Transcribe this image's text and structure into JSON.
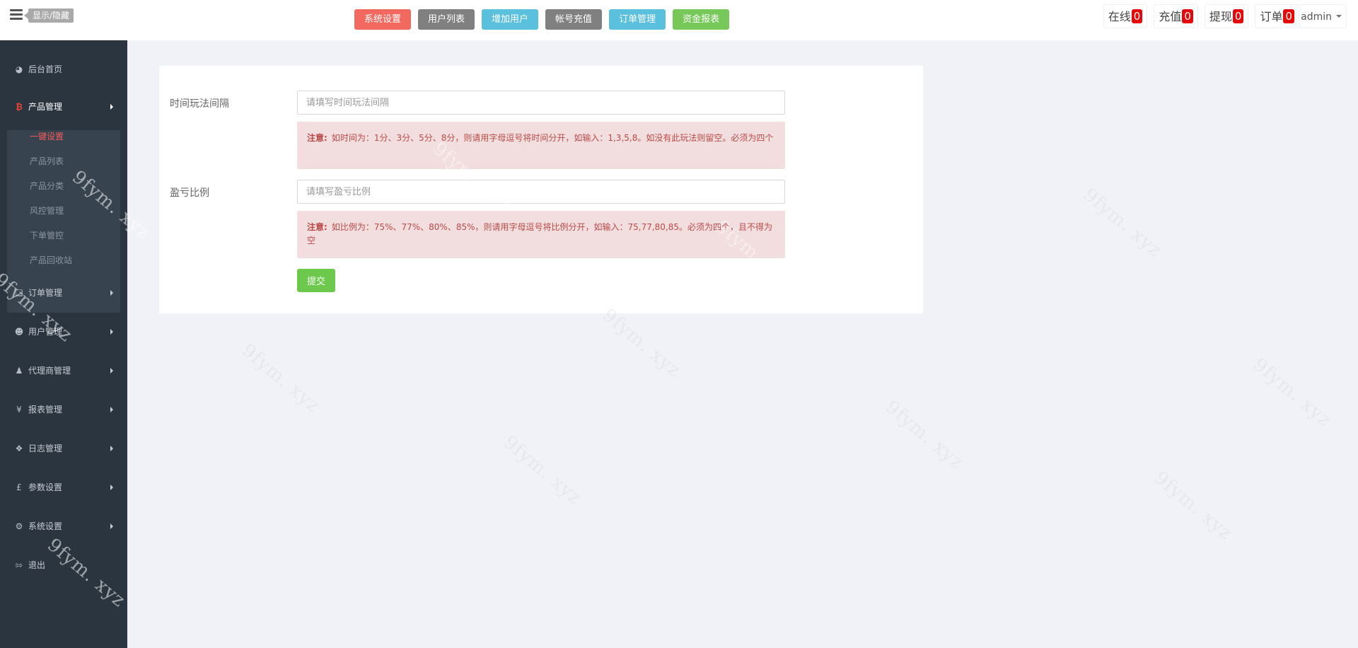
{
  "header": {
    "toggle_tip": "显示/隐藏",
    "quick_nav": [
      {
        "label": "系统设置",
        "color": "#f2695f"
      },
      {
        "label": "用户列表",
        "color": "#808080"
      },
      {
        "label": "增加用户",
        "color": "#5bc0de"
      },
      {
        "label": "帐号充值",
        "color": "#808080"
      },
      {
        "label": "订单管理",
        "color": "#5bc0de"
      },
      {
        "label": "资金报表",
        "color": "#76c959"
      }
    ],
    "stats": [
      {
        "label": "在线",
        "count": "0"
      },
      {
        "label": "充值",
        "count": "0"
      },
      {
        "label": "提现",
        "count": "0"
      },
      {
        "label": "订单",
        "count": "0"
      }
    ],
    "user": "admin"
  },
  "sidebar": {
    "items": [
      {
        "label": "后台首页",
        "icon": "dashboard-icon"
      },
      {
        "label": "产品管理",
        "icon": "bitcoin-icon"
      },
      {
        "label": "订单管理",
        "icon": "copy-icon"
      },
      {
        "label": "用户管理",
        "icon": "user-icon"
      },
      {
        "label": "代理商管理",
        "icon": "agent-icon"
      },
      {
        "label": "报表管理",
        "icon": "yen-icon"
      },
      {
        "label": "日志管理",
        "icon": "tag-icon"
      },
      {
        "label": "参数设置",
        "icon": "pound-icon"
      },
      {
        "label": "系统设置",
        "icon": "gears-icon"
      },
      {
        "label": "退出",
        "icon": "sign-out-icon"
      }
    ],
    "sub_items": [
      "一键设置",
      "产品列表",
      "产品分类",
      "风控管理",
      "下单管控",
      "产品回收站"
    ]
  },
  "form": {
    "field1": {
      "label": "时间玩法间隔",
      "placeholder": "请填写时间玩法间隔",
      "notice_title": "注意:",
      "notice_text": "如时间为：1分、3分、5分、8分，则请用字母逗号将时间分开，如输入：1,3,5,8。如没有此玩法则留空。必须为四个"
    },
    "field2": {
      "label": "盈亏比例",
      "placeholder": "请填写盈亏比例",
      "notice_title": "注意:",
      "notice_text": "如比例为：75%、77%、80%、85%，则请用字母逗号将比例分开，如输入：75,77,80,85。必须为四个，且不得为空"
    },
    "submit_label": "提交"
  },
  "watermark": "9fym. xyz"
}
